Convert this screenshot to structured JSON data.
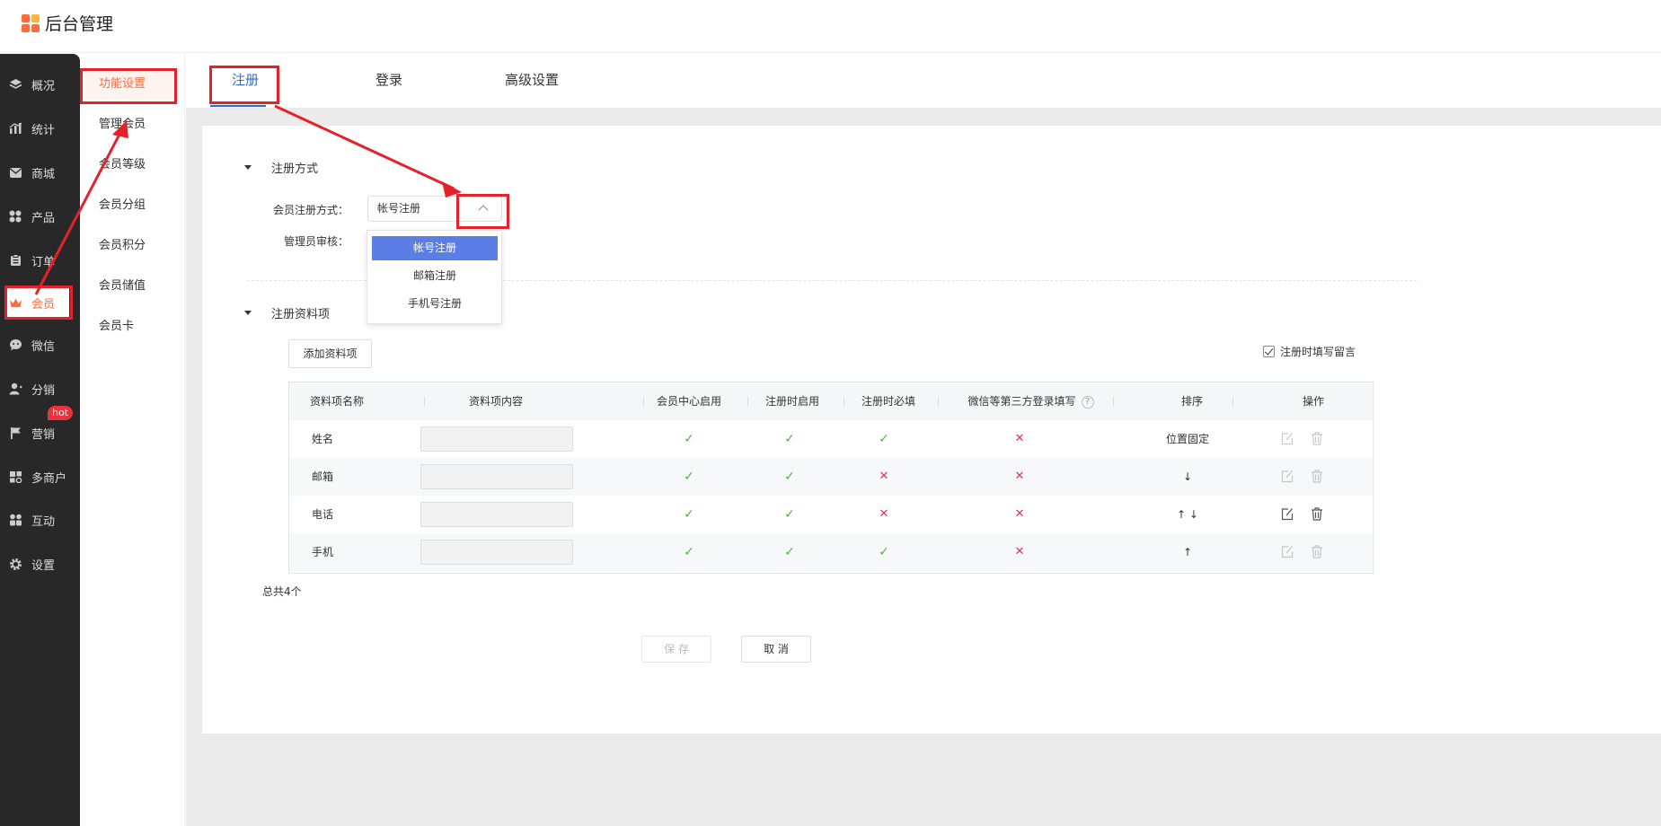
{
  "app": {
    "title": "后台管理"
  },
  "sidebar": {
    "items": [
      {
        "label": "概况",
        "icon": "layers-icon"
      },
      {
        "label": "统计",
        "icon": "chart-icon"
      },
      {
        "label": "商城",
        "icon": "mail-icon"
      },
      {
        "label": "产品",
        "icon": "grid-icon"
      },
      {
        "label": "订单",
        "icon": "order-icon"
      },
      {
        "label": "会员",
        "icon": "crown-icon",
        "active": true
      },
      {
        "label": "微信",
        "icon": "wechat-icon"
      },
      {
        "label": "分销",
        "icon": "user-icon"
      },
      {
        "label": "营销",
        "icon": "flag-icon",
        "badge": "hot"
      },
      {
        "label": "多商户",
        "icon": "store-icon"
      },
      {
        "label": "互动",
        "icon": "interact-icon"
      },
      {
        "label": "设置",
        "icon": "gear-icon"
      }
    ]
  },
  "subnav": {
    "items": [
      "功能设置",
      "管理会员",
      "会员等级",
      "会员分组",
      "会员积分",
      "会员储值",
      "会员卡"
    ]
  },
  "tabs": [
    "注册",
    "登录",
    "高级设置"
  ],
  "register_method": {
    "section_title": "注册方式",
    "method_label": "会员注册方式：",
    "selected": "帐号注册",
    "review_label": "管理员审核：",
    "options": [
      "帐号注册",
      "邮箱注册",
      "手机号注册"
    ]
  },
  "register_fields": {
    "section_title": "注册资料项",
    "add_button": "添加资料项",
    "message_checkbox": "注册时填写留言",
    "columns": [
      "资料项名称",
      "资料项内容",
      "会员中心启用",
      "注册时启用",
      "注册时必填",
      "微信等第三方登录填写",
      "排序",
      "操作"
    ],
    "help_mark": "?",
    "rows": [
      {
        "name": "姓名",
        "center": "✓",
        "reg_enable": "✓",
        "reg_required": "✓",
        "third": "✕",
        "sort": "位置固定"
      },
      {
        "name": "邮箱",
        "center": "✓",
        "reg_enable": "✓",
        "reg_required": "✕",
        "third": "✕",
        "sort": "↓"
      },
      {
        "name": "电话",
        "center": "✓",
        "reg_enable": "✓",
        "reg_required": "✕",
        "third": "✕",
        "sort": "↑ ↓"
      },
      {
        "name": "手机",
        "center": "✓",
        "reg_enable": "✓",
        "reg_required": "✓",
        "third": "✕",
        "sort": "↑"
      }
    ],
    "total": "总共4个"
  },
  "actions": {
    "save": "保 存",
    "cancel": "取 消"
  },
  "colors": {
    "accent": "#ff6b3d",
    "tab_active": "#2f6bd8",
    "annotation": "#e52229",
    "check": "#52b646",
    "cross": "#e4335c"
  }
}
